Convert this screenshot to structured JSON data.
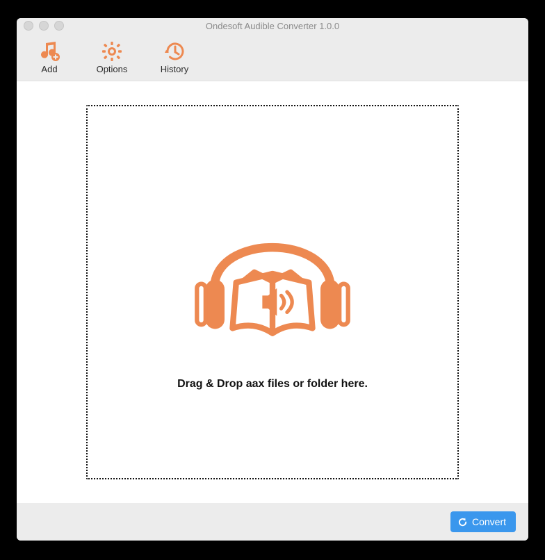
{
  "colors": {
    "accent": "#ed8951",
    "primary_button": "#3a97ed"
  },
  "window": {
    "title": "Ondesoft Audible Converter 1.0.0"
  },
  "toolbar": {
    "add": {
      "label": "Add",
      "icon": "music-add-icon"
    },
    "options": {
      "label": "Options",
      "icon": "gear-icon"
    },
    "history": {
      "label": "History",
      "icon": "history-icon"
    }
  },
  "dropzone": {
    "illustration": "headphones-audiobook-icon",
    "text": "Drag & Drop aax files or folder here."
  },
  "footer": {
    "convert": {
      "label": "Convert",
      "icon": "refresh-icon"
    }
  }
}
